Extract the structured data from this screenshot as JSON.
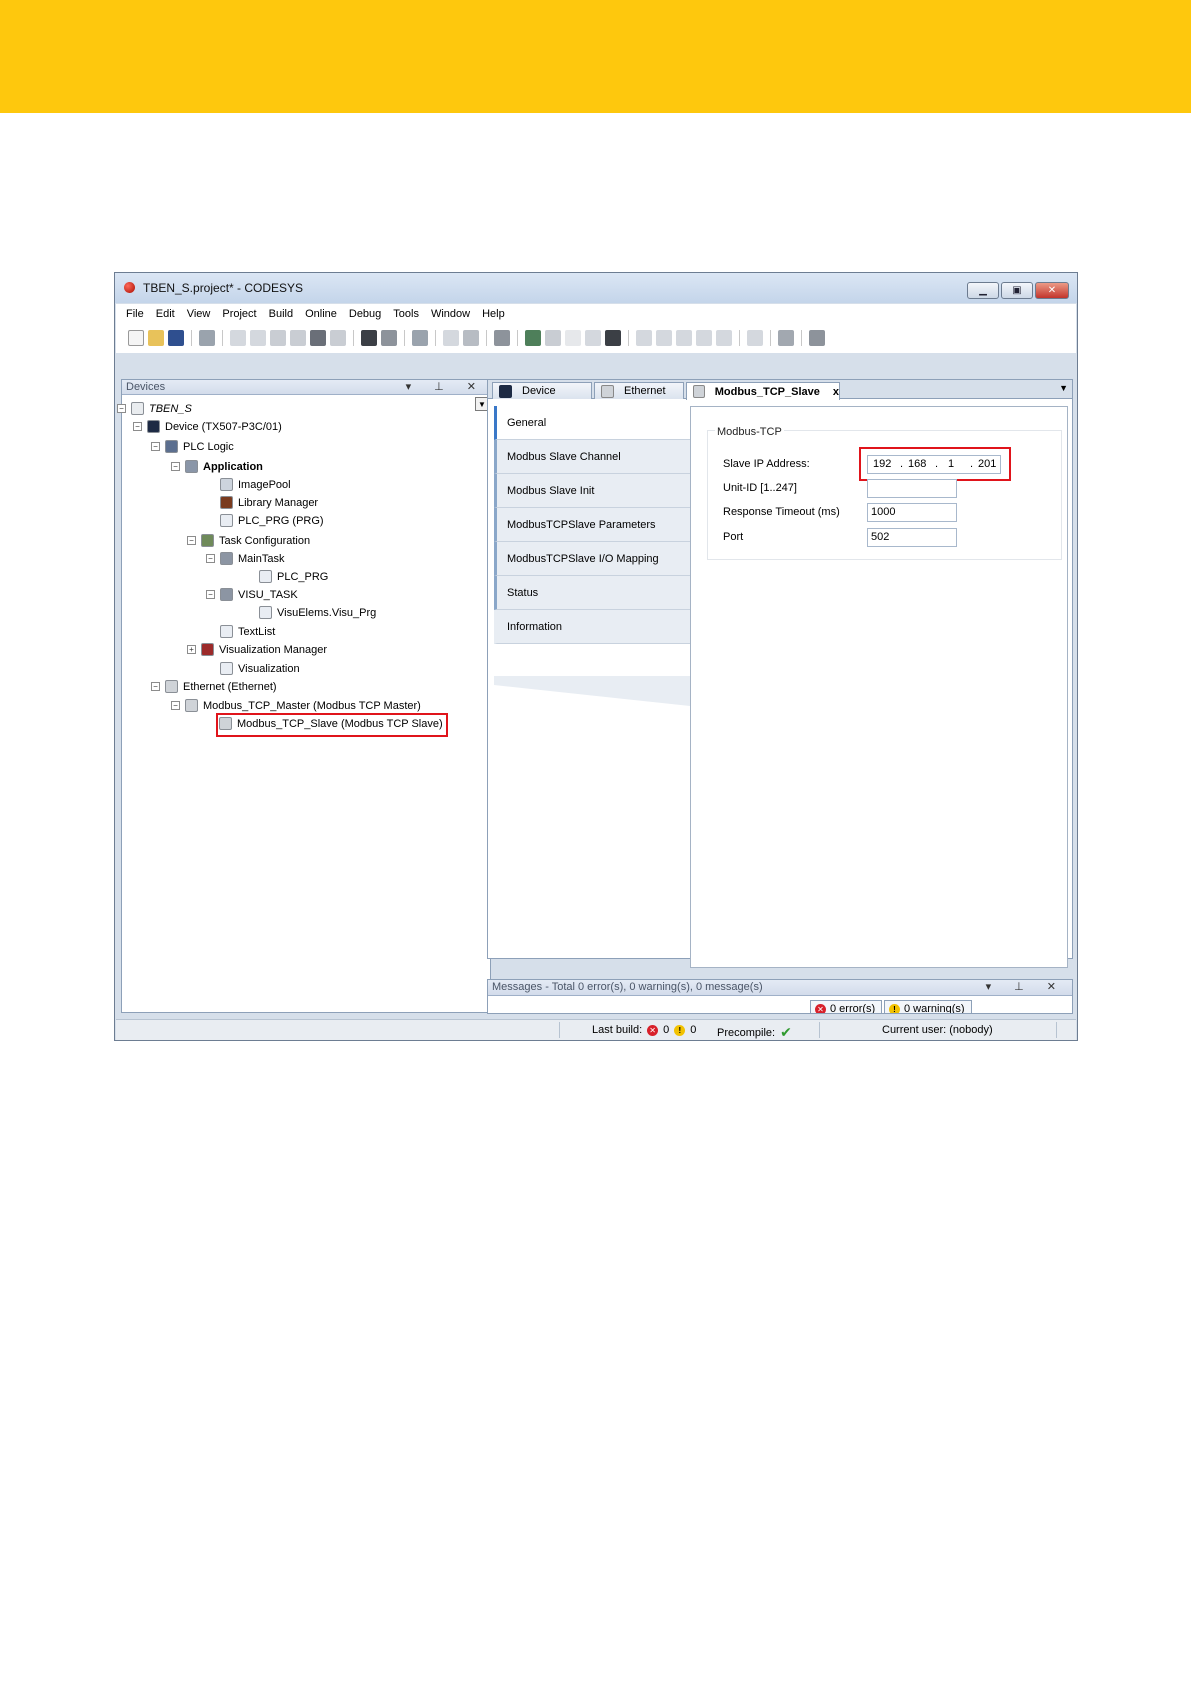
{
  "window": {
    "title": "TBEN_S.project* - CODESYS"
  },
  "menu": [
    "File",
    "Edit",
    "View",
    "Project",
    "Build",
    "Online",
    "Debug",
    "Tools",
    "Window",
    "Help"
  ],
  "devices": {
    "title": "Devices",
    "tree": [
      {
        "label": "TBEN_S",
        "icon": "project-icon",
        "exp": "−",
        "style": "italic"
      },
      {
        "label": "Device (TX507-P3C/01)",
        "icon": "device-icon",
        "exp": "−"
      },
      {
        "label": "PLC Logic",
        "icon": "plc-logic-icon",
        "exp": "−"
      },
      {
        "label": "Application",
        "icon": "application-gear-icon",
        "exp": "−",
        "style": "bold"
      },
      {
        "label": "ImagePool",
        "icon": "imagepool-icon"
      },
      {
        "label": "Library Manager",
        "icon": "library-icon"
      },
      {
        "label": "PLC_PRG (PRG)",
        "icon": "program-icon"
      },
      {
        "label": "Task Configuration",
        "icon": "task-config-icon",
        "exp": "−"
      },
      {
        "label": "MainTask",
        "icon": "task-icon",
        "exp": "−"
      },
      {
        "label": "PLC_PRG",
        "icon": "pou-call-icon"
      },
      {
        "label": "VISU_TASK",
        "icon": "task-icon",
        "exp": "−"
      },
      {
        "label": "VisuElems.Visu_Prg",
        "icon": "pou-call-icon"
      },
      {
        "label": "TextList",
        "icon": "textlist-icon"
      },
      {
        "label": "Visualization Manager",
        "icon": "visu-manager-icon",
        "exp": "+"
      },
      {
        "label": "Visualization",
        "icon": "visualization-icon"
      },
      {
        "label": "Ethernet (Ethernet)",
        "icon": "ethernet-icon",
        "exp": "−"
      },
      {
        "label": "Modbus_TCP_Master (Modbus TCP Master)",
        "icon": "modbus-master-icon",
        "exp": "−"
      },
      {
        "label": "Modbus_TCP_Slave (Modbus TCP Slave)",
        "icon": "modbus-slave-icon",
        "highlighted": true
      }
    ]
  },
  "editor": {
    "tabs": [
      {
        "label": "Device",
        "icon": "device-icon"
      },
      {
        "label": "Ethernet",
        "icon": "ethernet-icon"
      },
      {
        "label": "Modbus_TCP_Slave",
        "icon": "modbus-slave-icon",
        "active": true,
        "close": "x"
      }
    ],
    "side_tabs": [
      "General",
      "Modbus Slave Channel",
      "Modbus Slave Init",
      "ModbusTCPSlave Parameters",
      "ModbusTCPSlave I/O Mapping",
      "Status",
      "Information"
    ],
    "group_title": "Modbus-TCP",
    "fields": {
      "slave_ip_label": "Slave IP Address:",
      "ip": [
        "192",
        "168",
        "1",
        "201"
      ],
      "unit_id_label": "Unit-ID [1..247]",
      "unit_id_value": "",
      "timeout_label": "Response Timeout (ms)",
      "timeout_value": "1000",
      "port_label": "Port",
      "port_value": "502"
    }
  },
  "messages": {
    "title": "Messages - Total 0 error(s), 0 warning(s), 0 message(s)",
    "errors_chip": "0 error(s)",
    "warnings_chip": "0 warning(s)"
  },
  "status": {
    "last_build_label": "Last build:",
    "errors": "0",
    "warnings": "0",
    "precompile_label": "Precompile:",
    "user": "Current user: (nobody)"
  },
  "colors": {
    "banner": "#fec80d",
    "highlight": "#e0141b",
    "active_tab_stripe": "#3a78c8"
  }
}
